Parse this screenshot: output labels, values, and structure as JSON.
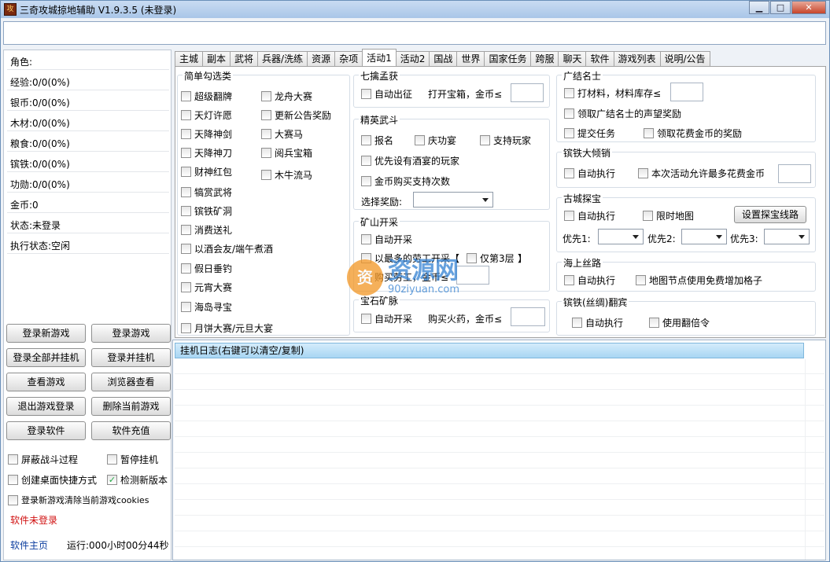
{
  "window": {
    "title": "三奇攻城掠地辅助 V1.9.3.5 (未登录)",
    "icon": "攻",
    "min_glyph": "▁",
    "max_glyph": "□",
    "close_glyph": "✕"
  },
  "stats": {
    "role": "角色:",
    "exp": "经验:0/0(0%)",
    "silver": "银币:0/0(0%)",
    "wood": "木材:0/0(0%)",
    "grain": "粮食:0/0(0%)",
    "iron": "镔铁:0/0(0%)",
    "merit": "功勋:0/0(0%)",
    "gold": "金币:0",
    "state": "状态:未登录",
    "exec_state": "执行状态:空闲"
  },
  "buttons": {
    "login_new": "登录新游戏",
    "login_game": "登录游戏",
    "login_all_hang": "登录全部并挂机",
    "login_hang": "登录并挂机",
    "view_game": "查看游戏",
    "browser_view": "浏览器查看",
    "logout_game": "退出游戏登录",
    "delete_game": "删除当前游戏",
    "login_software": "登录软件",
    "recharge": "软件充值"
  },
  "left_options": {
    "block_battle": "屏蔽战斗过程",
    "pause_hang": "暂停挂机",
    "desktop_shortcut": "创建桌面快捷方式",
    "check_version": "检测新版本",
    "clear_cookies": "登录新游戏清除当前游戏cookies"
  },
  "footer": {
    "software_status": "软件未登录",
    "home_link": "软件主页",
    "runtime": "运行:000小时00分44秒"
  },
  "tabs": [
    "主城",
    "副本",
    "武将",
    "兵器/洗练",
    "资源",
    "杂项",
    "活动1",
    "活动2",
    "国战",
    "世界",
    "国家任务",
    "跨服",
    "聊天",
    "软件",
    "游戏列表",
    "说明/公告"
  ],
  "simple": {
    "title": "简单勾选类",
    "col1": [
      "超级翻牌",
      "天灯许愿",
      "天降神剑",
      "天降神刀",
      "财神红包",
      "犒赏武将",
      "镔铁矿洞",
      "消费送礼",
      "以酒会友/端午煮酒",
      "假日垂钓",
      "元宵大赛",
      "海岛寻宝",
      "月饼大赛/元旦大宴"
    ],
    "col2": [
      "龙舟大赛",
      "更新公告奖励",
      "大赛马",
      "阅兵宝箱",
      "木牛流马"
    ]
  },
  "qiqin": {
    "title": "七擒孟获",
    "auto_expedition": "自动出征",
    "open_box": "打开宝箱，金币≤"
  },
  "elite": {
    "title": "精英武斗",
    "signup": "报名",
    "feast": "庆功宴",
    "support_player": "支持玩家",
    "prefer_wine": "优先设有酒宴的玩家",
    "gold_buy_support": "金币购买支持次数",
    "choose_reward": "选择奖励:"
  },
  "mine": {
    "title": "矿山开采",
    "auto_mine": "自动开采",
    "max_labor": "以最多的劳工开采【",
    "only_third": "仅第3层",
    "bracket_close": "】",
    "buy_labor": "购买劳工，金币≤"
  },
  "gem": {
    "title": "宝石矿脉",
    "auto_mine": "自动开采",
    "buy_powder": "购买火药，金币≤"
  },
  "guangjie": {
    "title": "广结名士",
    "make_material": "打材料，材料库存≤",
    "claim_reputation": "领取广结名士的声望奖励",
    "submit_task": "提交任务",
    "claim_gold_reward": "领取花费金币的奖励"
  },
  "bintie": {
    "title": "镔铁大倾销",
    "auto_exec": "自动执行",
    "max_gold": "本次活动允许最多花费金币"
  },
  "gucheng": {
    "title": "古城探宝",
    "auto_exec": "自动执行",
    "limited_map": "限时地图",
    "set_route": "设置探宝线路",
    "p1": "优先1:",
    "p2": "优先2:",
    "p3": "优先3:"
  },
  "haishang": {
    "title": "海上丝路",
    "auto_exec": "自动执行",
    "free_grid": "地图节点使用免费增加格子"
  },
  "silk": {
    "title": "镔铁(丝绸)翻宾",
    "auto_exec": "自动执行",
    "use_double": "使用翻倍令"
  },
  "log": {
    "header": "挂机日志(右键可以清空/复制)"
  },
  "watermark": {
    "logo": "资",
    "text1": "资源网",
    "text2": "90ziyuan.com"
  }
}
